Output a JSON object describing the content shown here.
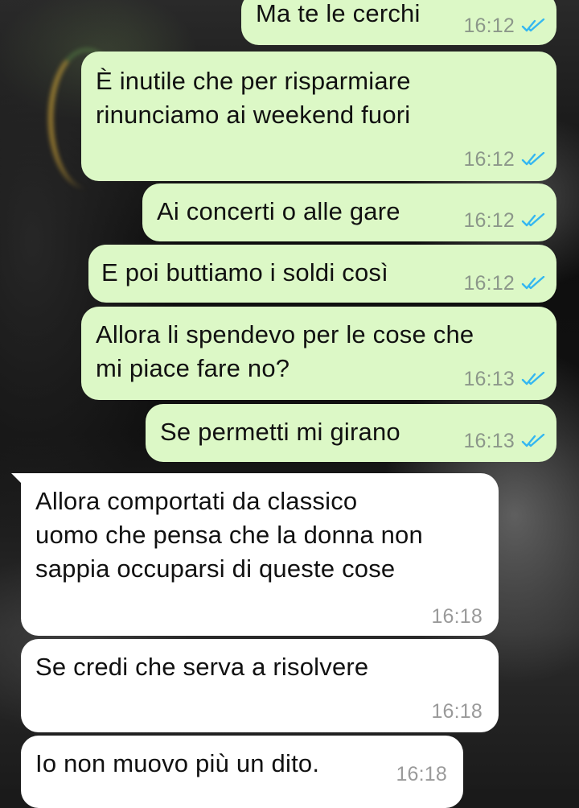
{
  "colors": {
    "outgoing_bubble": "#dcf8c6",
    "incoming_bubble": "#ffffff",
    "read_ticks": "#34b7f1",
    "timestamp": "#8c978a"
  },
  "messages": [
    {
      "direction": "outgoing",
      "text": "Ma te le cerchi",
      "time": "16:12",
      "status_icon": "double-check-read-icon"
    },
    {
      "direction": "outgoing",
      "text": "È inutile che per risparmiare\nrinunciamo ai weekend fuori",
      "time": "16:12",
      "status_icon": "double-check-read-icon"
    },
    {
      "direction": "outgoing",
      "text": "Ai concerti o alle gare",
      "time": "16:12",
      "status_icon": "double-check-read-icon"
    },
    {
      "direction": "outgoing",
      "text": "E poi buttiamo i soldi così",
      "time": "16:12",
      "status_icon": "double-check-read-icon"
    },
    {
      "direction": "outgoing",
      "text": "Allora li spendevo per le cose che\nmi piace fare no?",
      "time": "16:13",
      "status_icon": "double-check-read-icon"
    },
    {
      "direction": "outgoing",
      "text": "Se permetti mi girano",
      "time": "16:13",
      "status_icon": "double-check-read-icon"
    },
    {
      "direction": "incoming",
      "text": "Allora comportati da classico\nuomo che pensa che la donna non\nsappia occuparsi di queste cose",
      "time": "16:18"
    },
    {
      "direction": "incoming",
      "text": "Se credi che serva a risolvere",
      "time": "16:18"
    },
    {
      "direction": "incoming",
      "text": "Io non muovo più un dito.",
      "time": "16:18"
    }
  ]
}
